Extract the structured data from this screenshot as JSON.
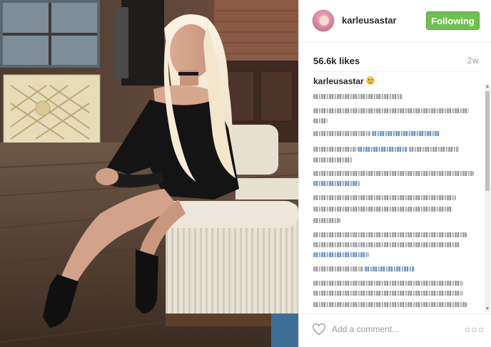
{
  "post": {
    "username": "karleusastar",
    "follow_label": "Following",
    "likes": "56.6k likes",
    "age": "2w"
  },
  "caption": {
    "username": "karleusastar",
    "emoji": "smiling-face-emoji"
  },
  "comment_box": {
    "placeholder": "Add a comment..."
  },
  "icons": {
    "like": "heart-icon",
    "options": "more-options-icon"
  },
  "colors": {
    "follow_button": "#70c050",
    "link_text": "#003569",
    "muted_text": "#999999"
  }
}
